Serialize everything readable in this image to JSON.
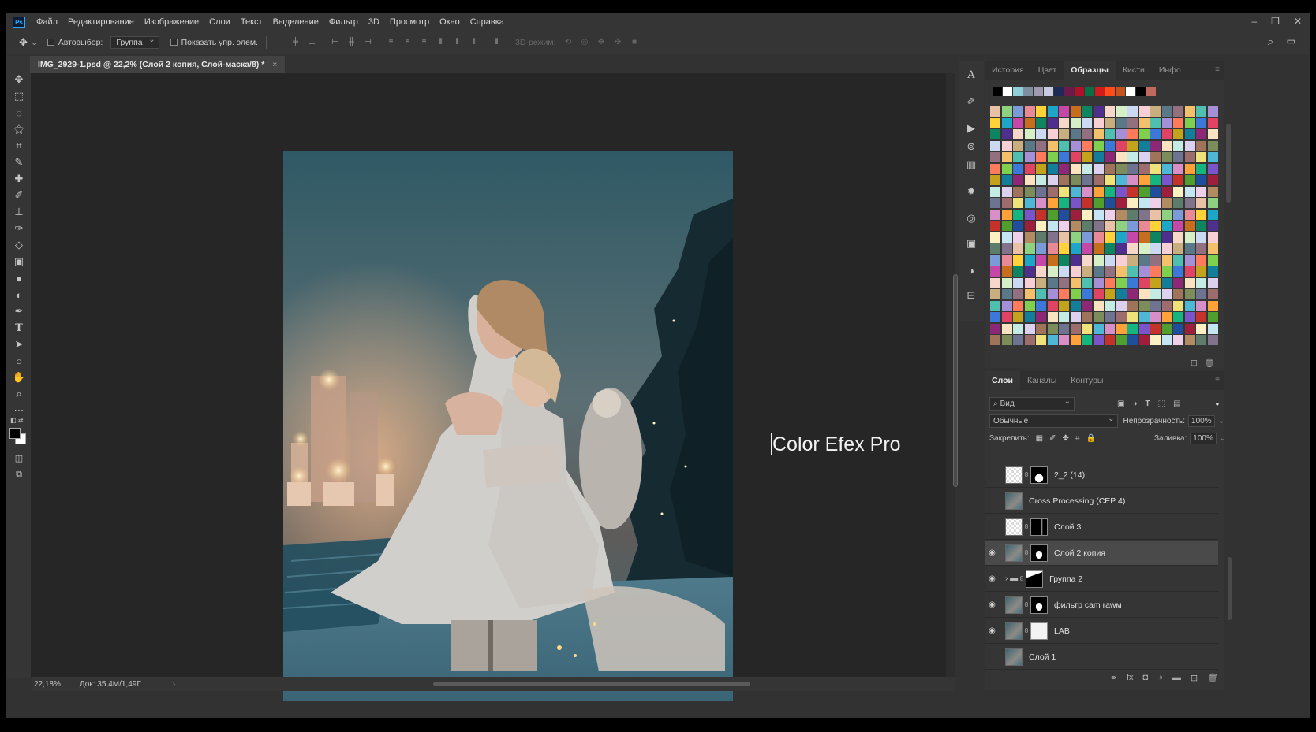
{
  "app": {
    "logo": "Ps"
  },
  "menu": [
    "Файл",
    "Редактирование",
    "Изображение",
    "Слои",
    "Текст",
    "Выделение",
    "Фильтр",
    "3D",
    "Просмотр",
    "Окно",
    "Справка"
  ],
  "window_controls": [
    "‒",
    "❐",
    "✕"
  ],
  "options": {
    "autoselect_label": "Автовыбор:",
    "autoselect_value": "Группа",
    "show_controls_label": "Показать упр. элем.",
    "mode3d_label": "3D-режим:"
  },
  "document_tab": {
    "title": "IMG_2929-1.psd @ 22,2% (Слой 2 копия, Слой-маска/8) *",
    "close": "×"
  },
  "canvas": {
    "overlay_text": "Color Efex Pro"
  },
  "status": {
    "zoom": "22,18%",
    "doc": "Док: 35,4M/1,49Г",
    "arrow": "›"
  },
  "swatches_panel": {
    "tabs": [
      "История",
      "Цвет",
      "Образцы",
      "Кисти",
      "Инфо"
    ],
    "active_tab": "Образцы",
    "recent": [
      "#000000",
      "#ffffff",
      "#8fd0d8",
      "#7f8f9f",
      "#a09ab0",
      "#c8cce0",
      "#1c2a55",
      "#6b1a4a",
      "#b0102a",
      "#0c6e43",
      "#d01c1c",
      "#ff4d1a",
      "#c7521e",
      "#ffffff",
      "#000000",
      "#c06a5e"
    ]
  },
  "layers_panel": {
    "tabs": [
      "Слои",
      "Каналы",
      "Контуры"
    ],
    "active_tab": "Слои",
    "filter_placeholder": "Вид",
    "blend_mode": "Обычные",
    "opacity_label": "Непрозрачность:",
    "opacity_value": "100%",
    "lock_label": "Закрепить:",
    "fill_label": "Заливка:",
    "fill_value": "100%",
    "layers": [
      {
        "name": "2_2 (14)",
        "visible": false,
        "selected": false
      },
      {
        "name": "Cross Processing (CEP 4)",
        "visible": false,
        "selected": false
      },
      {
        "name": "Слой 3",
        "visible": false,
        "selected": false
      },
      {
        "name": "Слой 2 копия",
        "visible": true,
        "selected": true
      },
      {
        "name": "Группа 2",
        "visible": true,
        "selected": false
      },
      {
        "name": "фильтр cam rawм",
        "visible": true,
        "selected": false
      },
      {
        "name": "LAB",
        "visible": true,
        "selected": false
      },
      {
        "name": "Слой 1",
        "visible": false,
        "selected": false
      }
    ]
  }
}
